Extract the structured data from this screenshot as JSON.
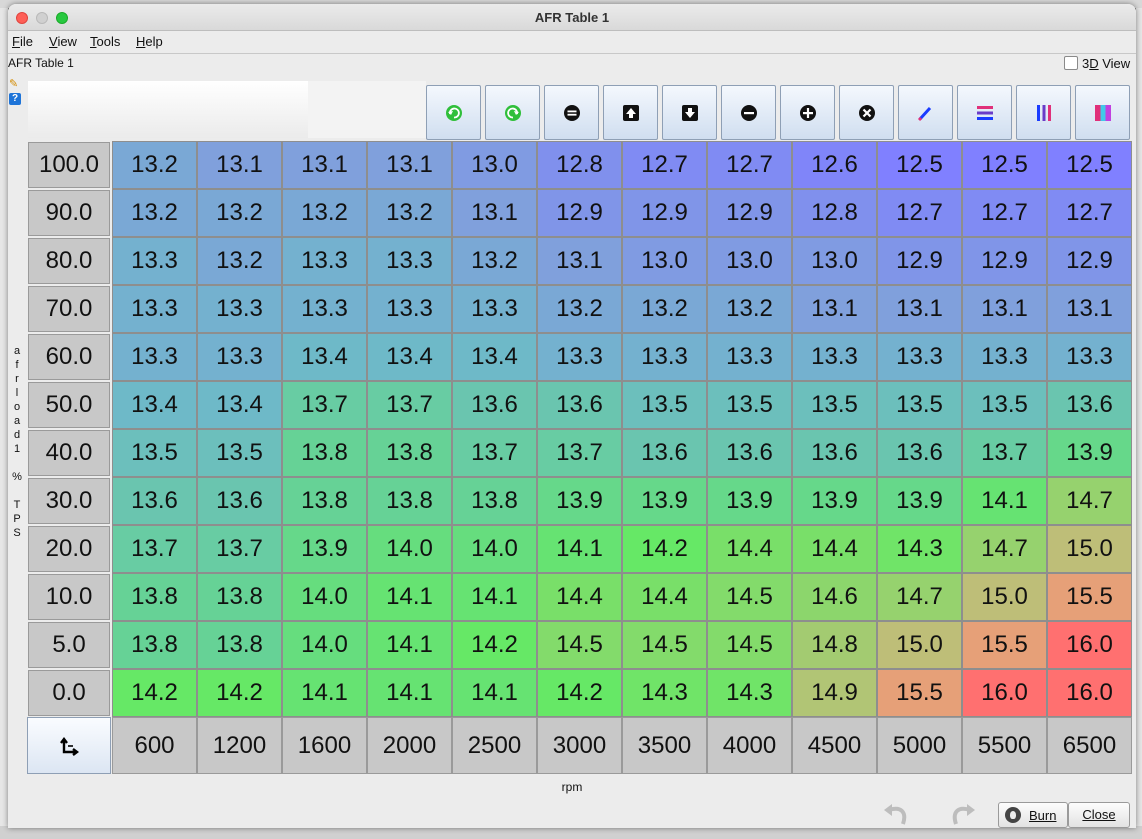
{
  "window": {
    "title": "AFR Table 1"
  },
  "menu": [
    {
      "label": "File",
      "mnemonic": "F",
      "rest": "ile"
    },
    {
      "label": "View",
      "mnemonic": "V",
      "rest": "iew"
    },
    {
      "label": "Tools",
      "mnemonic": "T",
      "rest": "ools"
    },
    {
      "label": "Help",
      "mnemonic": "H",
      "rest": "elp"
    }
  ],
  "table_name": "AFR Table 1",
  "view3d": {
    "pre": "3",
    "mnemonic": "D",
    "post": " View",
    "checked": false
  },
  "toolbar_icons": [
    "increase-green-icon",
    "decrease-green-icon",
    "equals-icon",
    "arrow-up-icon",
    "arrow-down-icon",
    "minus-icon",
    "plus-icon",
    "multiply-icon",
    "pencil-icon",
    "horizontal-interpolate-icon",
    "vertical-interpolate-icon",
    "gradient-interpolate-icon"
  ],
  "y_axis": {
    "label_chars": [
      "a",
      "f",
      "r",
      "l",
      "o",
      "a",
      "d",
      "1",
      "",
      "%",
      "",
      "T",
      "P",
      "S"
    ],
    "values": [
      "100.0",
      "90.0",
      "80.0",
      "70.0",
      "60.0",
      "50.0",
      "40.0",
      "30.0",
      "20.0",
      "10.0",
      "5.0",
      "0.0"
    ]
  },
  "x_axis": {
    "label": "rpm",
    "values": [
      "600",
      "1200",
      "1600",
      "2000",
      "2500",
      "3000",
      "3500",
      "4000",
      "4500",
      "5000",
      "5500",
      "6500"
    ]
  },
  "cells": [
    [
      "13.2",
      "13.1",
      "13.1",
      "13.1",
      "13.0",
      "12.8",
      "12.7",
      "12.7",
      "12.6",
      "12.5",
      "12.5",
      "12.5"
    ],
    [
      "13.2",
      "13.2",
      "13.2",
      "13.2",
      "13.1",
      "12.9",
      "12.9",
      "12.9",
      "12.8",
      "12.7",
      "12.7",
      "12.7"
    ],
    [
      "13.3",
      "13.2",
      "13.3",
      "13.3",
      "13.2",
      "13.1",
      "13.0",
      "13.0",
      "13.0",
      "12.9",
      "12.9",
      "12.9"
    ],
    [
      "13.3",
      "13.3",
      "13.3",
      "13.3",
      "13.3",
      "13.2",
      "13.2",
      "13.2",
      "13.1",
      "13.1",
      "13.1",
      "13.1"
    ],
    [
      "13.3",
      "13.3",
      "13.4",
      "13.4",
      "13.4",
      "13.3",
      "13.3",
      "13.3",
      "13.3",
      "13.3",
      "13.3",
      "13.3"
    ],
    [
      "13.4",
      "13.4",
      "13.7",
      "13.7",
      "13.6",
      "13.6",
      "13.5",
      "13.5",
      "13.5",
      "13.5",
      "13.5",
      "13.6"
    ],
    [
      "13.5",
      "13.5",
      "13.8",
      "13.8",
      "13.7",
      "13.7",
      "13.6",
      "13.6",
      "13.6",
      "13.6",
      "13.7",
      "13.9"
    ],
    [
      "13.6",
      "13.6",
      "13.8",
      "13.8",
      "13.8",
      "13.9",
      "13.9",
      "13.9",
      "13.9",
      "13.9",
      "14.1",
      "14.7"
    ],
    [
      "13.7",
      "13.7",
      "13.9",
      "14.0",
      "14.0",
      "14.1",
      "14.2",
      "14.4",
      "14.4",
      "14.3",
      "14.7",
      "15.0"
    ],
    [
      "13.8",
      "13.8",
      "14.0",
      "14.1",
      "14.1",
      "14.4",
      "14.4",
      "14.5",
      "14.6",
      "14.7",
      "15.0",
      "15.5"
    ],
    [
      "13.8",
      "13.8",
      "14.0",
      "14.1",
      "14.2",
      "14.5",
      "14.5",
      "14.5",
      "14.8",
      "15.0",
      "15.5",
      "16.0"
    ],
    [
      "14.2",
      "14.2",
      "14.1",
      "14.1",
      "14.1",
      "14.2",
      "14.3",
      "14.3",
      "14.9",
      "15.5",
      "16.0",
      "16.0"
    ]
  ],
  "buttons": {
    "burn_pre": "",
    "burn_mnemonic": "Burn",
    "close_mnemonic": "Close"
  },
  "colors": {
    "lean": "#8080ff",
    "mid": "#66e866",
    "rich": "#ff7070"
  }
}
